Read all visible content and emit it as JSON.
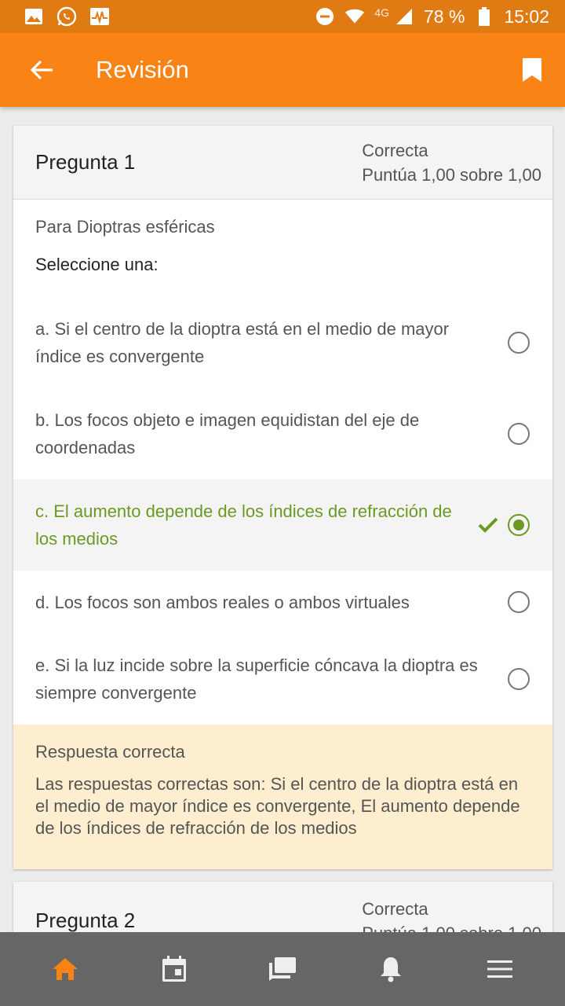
{
  "status_bar": {
    "network": "4G",
    "battery": "78 %",
    "time": "15:02"
  },
  "app_bar": {
    "title": "Revisión"
  },
  "question1": {
    "title": "Pregunta 1",
    "status": "Correcta",
    "score": "Puntúa 1,00 sobre 1,00",
    "text": "Para Dioptras esféricas",
    "prompt": "Seleccione una:",
    "answers": [
      {
        "text": "a. Si el centro de la dioptra está en el medio de mayor índice es convergente"
      },
      {
        "text": "b. Los focos objeto e imagen equidistan del eje de coordenadas"
      },
      {
        "text": "c. El aumento depende de los índices de refracción de los medios"
      },
      {
        "text": "d. Los focos son ambos reales o ambos virtuales"
      },
      {
        "text": "e. Si la luz incide sobre la superficie cóncava la dioptra es siempre convergente"
      }
    ],
    "feedback_title": "Respuesta correcta",
    "feedback_body": "Las respuestas correctas son: Si el centro de la dioptra está en el medio de mayor índice es convergente, El aumento depende de los índices de refracción de los medios"
  },
  "question2": {
    "title": "Pregunta 2",
    "status": "Correcta",
    "score": "Puntúa 1,00 sobre 1,00"
  },
  "colors": {
    "app_bar": "#f98314",
    "status_bar": "#e07a12",
    "correct": "#6a9a23",
    "feedback_bg": "#fdeecf",
    "bottom_nav": "#666666",
    "active_nav": "#f98314"
  },
  "icons": {
    "back": "arrow-left-icon",
    "bookmark": "bookmark-icon",
    "nav": [
      "home-icon",
      "calendar-icon",
      "messages-icon",
      "bell-icon",
      "menu-icon"
    ]
  }
}
